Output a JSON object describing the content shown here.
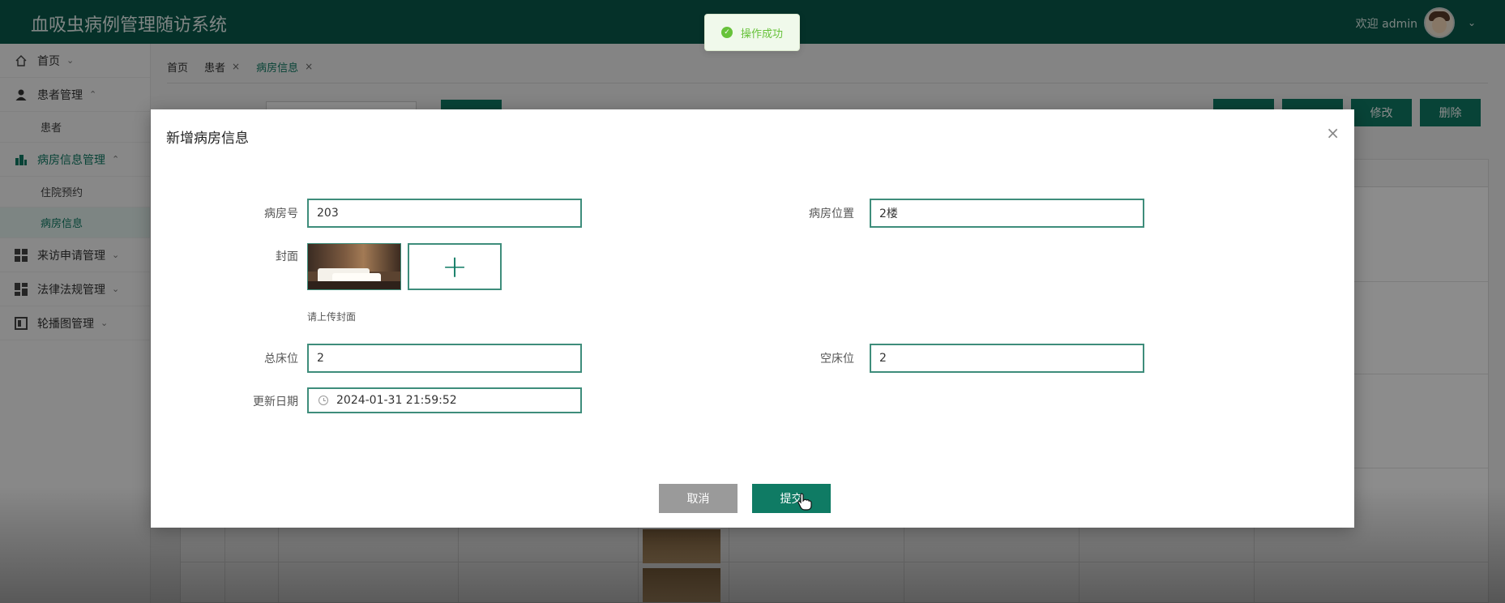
{
  "header": {
    "title": "血吸虫病例管理随访系统",
    "welcome": "欢迎 admin",
    "caret": "⌄"
  },
  "sidebar": {
    "items": [
      {
        "label": "首页",
        "arrow": "⌄"
      },
      {
        "label": "患者管理",
        "arrow": "⌃"
      },
      {
        "label": "患者"
      },
      {
        "label": "病房信息管理",
        "arrow": "⌃"
      },
      {
        "label": "住院预约"
      },
      {
        "label": "病房信息"
      },
      {
        "label": "来访申请管理",
        "arrow": "⌄"
      },
      {
        "label": "法律法规管理",
        "arrow": "⌄"
      },
      {
        "label": "轮播图管理",
        "arrow": "⌄"
      }
    ]
  },
  "tabs": [
    {
      "label": "首页"
    },
    {
      "label": "患者",
      "close": "×"
    },
    {
      "label": "病房信息",
      "close": "×"
    }
  ],
  "toolbar": {
    "edit_label": "修改",
    "delete_label": "删除"
  },
  "toast": {
    "message": "操作成功",
    "check": "✓"
  },
  "modal": {
    "title": "新增病房信息",
    "close": "×",
    "room_no_label": "病房号",
    "room_no_value": "203",
    "location_label": "病房位置",
    "location_value": "2楼",
    "cover_label": "封面",
    "upload_plus": "+",
    "cover_hint": "请上传封面",
    "total_beds_label": "总床位",
    "total_beds_value": "2",
    "empty_beds_label": "空床位",
    "empty_beds_value": "2",
    "update_date_label": "更新日期",
    "update_date_value": "2024-01-31 21:59:52",
    "cancel_label": "取消",
    "submit_label": "提交"
  },
  "colors": {
    "primary": "#0f7b64",
    "header": "#0a5a4b",
    "toast_success": "#67c23a"
  }
}
